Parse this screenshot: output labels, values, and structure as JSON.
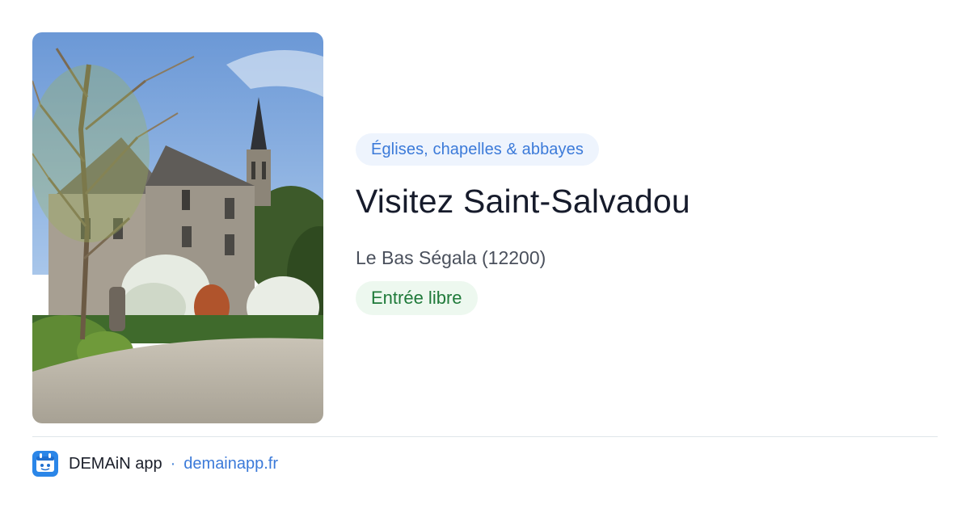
{
  "card": {
    "category": "Églises, chapelles & abbayes",
    "title": "Visitez Saint-Salvadou",
    "location": "Le Bas Ségala (12200)",
    "access": "Entrée libre",
    "image_subject": "stone-house-and-church-steeple-photo"
  },
  "footer": {
    "app_name": "DEMAiN app",
    "separator": "·",
    "site": "demainapp.fr",
    "icon": "demain-app-logo-icon"
  },
  "colors": {
    "category_text": "#3b7ad9",
    "category_bg": "#eef4fd",
    "access_text": "#1f7a3a",
    "access_bg": "#edf8ef",
    "title": "#161b2b",
    "link": "#3b7ad9"
  }
}
